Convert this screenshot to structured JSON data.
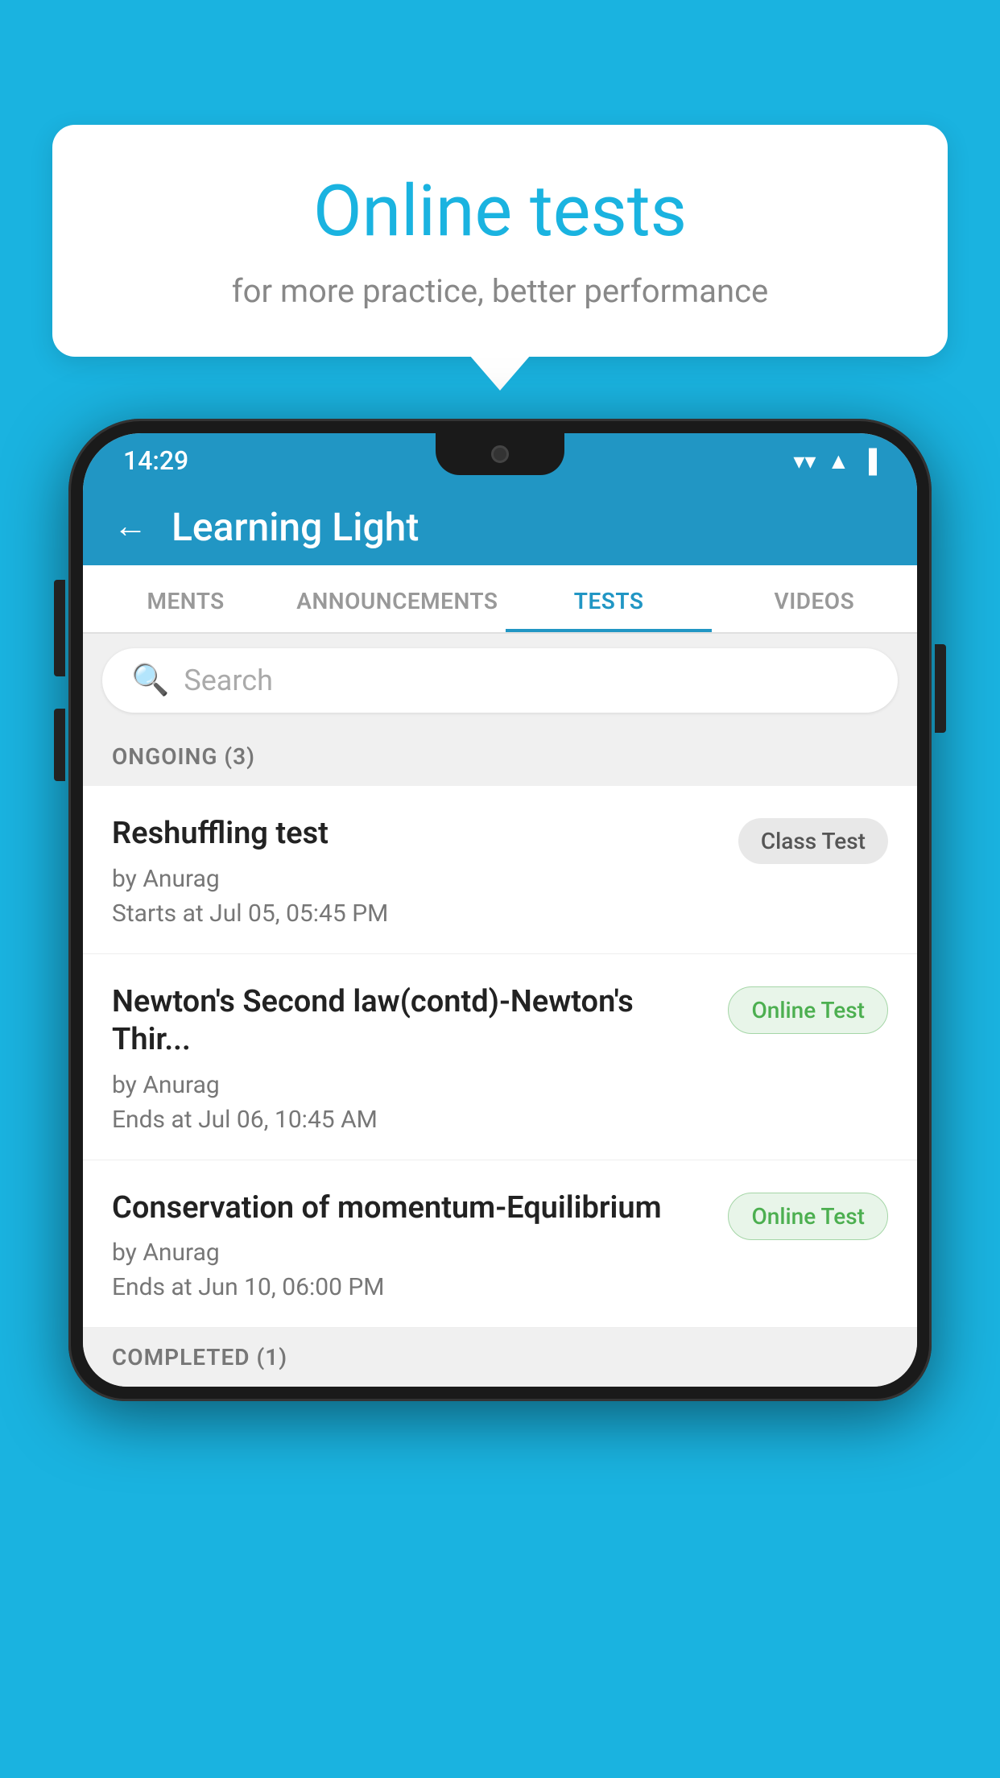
{
  "background": {
    "color": "#1ab3e0"
  },
  "speech_bubble": {
    "title": "Online tests",
    "subtitle": "for more practice, better performance"
  },
  "phone": {
    "status_bar": {
      "time": "14:29",
      "icons": [
        "wifi",
        "signal",
        "battery"
      ]
    },
    "app_header": {
      "back_label": "←",
      "title": "Learning Light"
    },
    "tabs": [
      {
        "label": "MENTS",
        "active": false
      },
      {
        "label": "ANNOUNCEMENTS",
        "active": false
      },
      {
        "label": "TESTS",
        "active": true
      },
      {
        "label": "VIDEOS",
        "active": false
      }
    ],
    "search": {
      "placeholder": "Search"
    },
    "ongoing_section": {
      "header": "ONGOING (3)",
      "tests": [
        {
          "name": "Reshuffling test",
          "author": "by Anurag",
          "time_label": "Starts at",
          "time": "Jul 05, 05:45 PM",
          "badge": "Class Test",
          "badge_type": "class"
        },
        {
          "name": "Newton's Second law(contd)-Newton's Thir...",
          "author": "by Anurag",
          "time_label": "Ends at",
          "time": "Jul 06, 10:45 AM",
          "badge": "Online Test",
          "badge_type": "online"
        },
        {
          "name": "Conservation of momentum-Equilibrium",
          "author": "by Anurag",
          "time_label": "Ends at",
          "time": "Jun 10, 06:00 PM",
          "badge": "Online Test",
          "badge_type": "online"
        }
      ]
    },
    "completed_section": {
      "header": "COMPLETED (1)"
    }
  }
}
